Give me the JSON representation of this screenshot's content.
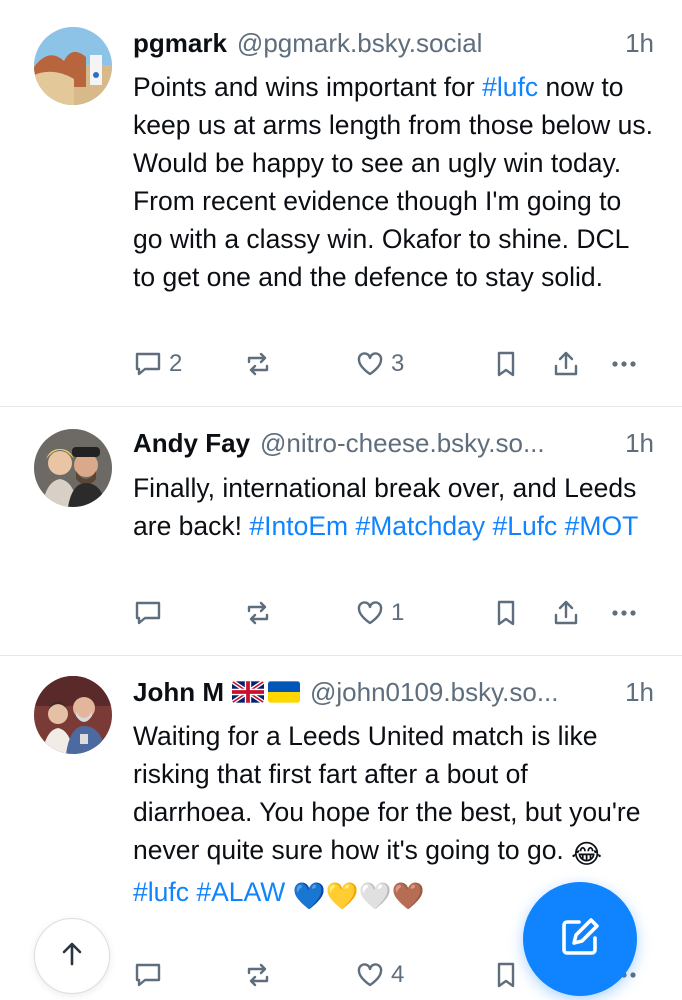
{
  "posts": [
    {
      "name": "pgmark",
      "handle": "@pgmark.bsky.social",
      "time": "1h",
      "text_parts": [
        {
          "t": "Points and wins important for "
        },
        {
          "t": "#lufc",
          "tag": true
        },
        {
          "t": " now to keep us at arms length from those below us. Would be happy to see an ugly win today. From recent evidence though I'm going to go with a classy win. Okafor to shine. DCL to get one and the defence to stay solid."
        }
      ],
      "reply_count": "2",
      "repost_count": "",
      "like_count": "3"
    },
    {
      "name": "Andy Fay",
      "handle": "@nitro-cheese.bsky.so...",
      "time": "1h",
      "text_parts": [
        {
          "t": "Finally, international break over, and Leeds are back! "
        },
        {
          "t": "#IntoEm",
          "tag": true
        },
        {
          "t": " "
        },
        {
          "t": "#Matchday",
          "tag": true
        },
        {
          "t": " "
        },
        {
          "t": "#Lufc",
          "tag": true
        },
        {
          "t": " "
        },
        {
          "t": "#MOT",
          "tag": true
        }
      ],
      "reply_count": "",
      "repost_count": "",
      "like_count": "1"
    },
    {
      "name": "John M",
      "flags": [
        "uk-flag",
        "ukraine-flag"
      ],
      "handle": "@john0109.bsky.so...",
      "time": "1h",
      "text_parts": [
        {
          "t": "Waiting for a Leeds United match is like risking that first fart after a bout of diarrhoea.  You hope for the best, but you're never quite sure how it's going to go. "
        },
        {
          "t": "😂",
          "emoji": true
        },
        {
          "t": " "
        },
        {
          "t": "#lufc",
          "tag": true
        },
        {
          "t": " "
        },
        {
          "t": "#ALAW",
          "tag": true
        },
        {
          "t": " "
        },
        {
          "t": "💙💛🤍🤎",
          "emoji": true
        }
      ],
      "reply_count": "",
      "repost_count": "",
      "like_count": "4"
    }
  ],
  "icons": {
    "reply": "reply-bubble-icon",
    "repost": "repost-icon",
    "like": "heart-icon",
    "bookmark": "bookmark-icon",
    "share": "share-icon",
    "more": "more-dots-icon",
    "compose": "compose-icon",
    "scroll_top": "arrow-up-icon"
  },
  "colors": {
    "accent": "#1083fe",
    "muted": "#5f6e7d",
    "text": "#0b0f14",
    "divider": "#e4e7eb"
  }
}
